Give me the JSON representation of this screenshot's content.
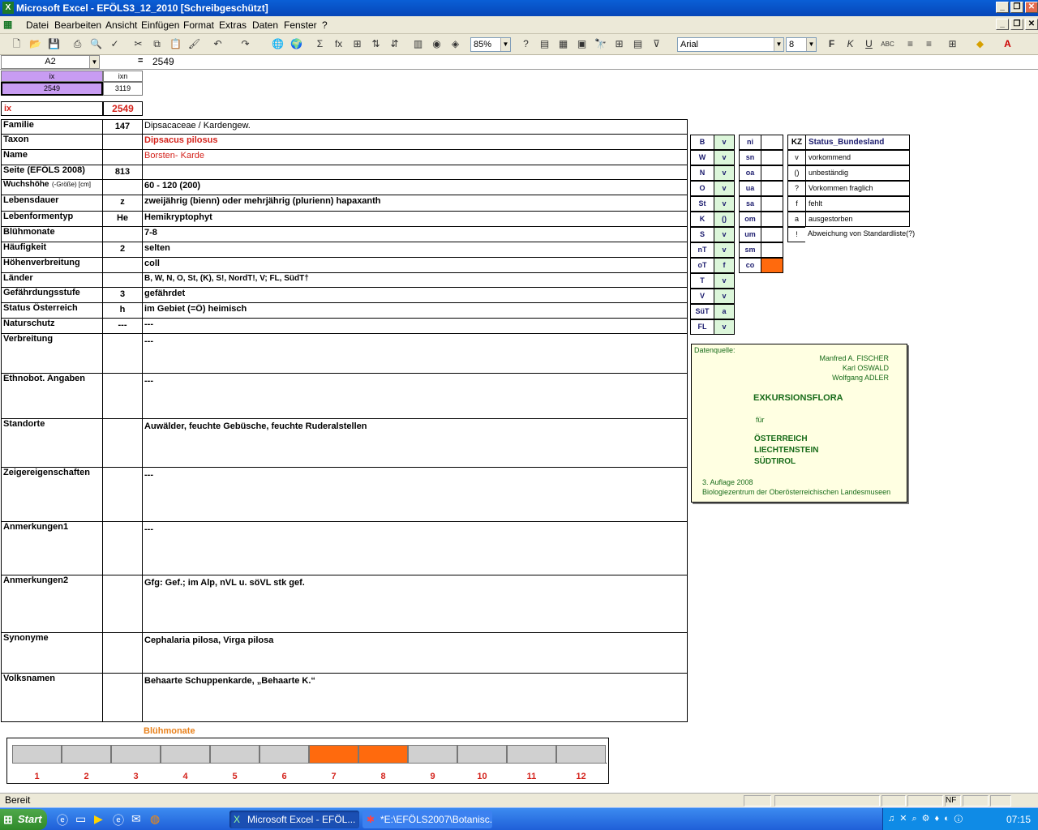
{
  "window": {
    "title": "Microsoft Excel - EFÖLS3_12_2010  [Schreibgeschützt]"
  },
  "menu": [
    "Datei",
    "Bearbeiten",
    "Ansicht",
    "Einfügen",
    "Format",
    "Extras",
    "Daten",
    "Fenster",
    "?"
  ],
  "toolbar": {
    "zoom": "85%",
    "font": "Arial",
    "font_size": "8"
  },
  "formula": {
    "namebox": "A2",
    "fx": "=",
    "value": "2549"
  },
  "header": {
    "ix_label": "ix",
    "ixn_label": "ixn",
    "ix_value": "2549",
    "ixn_value": "3119",
    "ix2_label": "ix",
    "ix2_value": "2549"
  },
  "rows": [
    {
      "label": "Familie",
      "code": "147",
      "value": "Dipsacaceae  /  Kardengew."
    },
    {
      "label": "Taxon",
      "code": "",
      "value": "Dipsacus pilosus"
    },
    {
      "label": "Name",
      "code": "",
      "value": "Borsten- Karde"
    },
    {
      "label": "Seite (EFÖLS 2008)",
      "code": "813",
      "value": ""
    },
    {
      "label": "Wuchshöhe",
      "label_small": "(-Größe) [cm]",
      "code": "",
      "value": " 60 - 120 (200)"
    },
    {
      "label": "Lebensdauer",
      "code": "z",
      "value": "zweijährig (bienn) oder mehrjährig (plurienn) hapaxanth"
    },
    {
      "label": "Lebenformentyp",
      "code": "He",
      "value": "Hemikryptophyt"
    },
    {
      "label": "Blühmonate",
      "code": "",
      "value": " 7-8"
    },
    {
      "label": "Häufigkeit",
      "code": "2",
      "value": "selten"
    },
    {
      "label": "Höhenverbreitung",
      "code": "",
      "value": "coll"
    },
    {
      "label": "Länder",
      "code": "",
      "value": "B, W, N, O, St, (K), S!, NordT!, V; FL, SüdT†"
    },
    {
      "label": "Gefährdungsstufe",
      "code": "3",
      "value": "gefährdet"
    },
    {
      "label": "Status Österreich",
      "code": "h",
      "value": "im Gebiet (=Ö) heimisch"
    },
    {
      "label": "Naturschutz",
      "code": "---",
      "value": " ---"
    },
    {
      "label": "Verbreitung",
      "code": "",
      "value": " ---"
    },
    {
      "label": "Ethnobot. Angaben",
      "code": "",
      "value": "---"
    },
    {
      "label": "Standorte",
      "code": "",
      "value": "Auwälder, feuchte Gebüsche, feuchte Ruderalstellen"
    },
    {
      "label": "Zeigereigenschaften",
      "code": "",
      "value": "---"
    },
    {
      "label": "Anmerkungen1",
      "code": "",
      "value": "---"
    },
    {
      "label": "Anmerkungen2",
      "code": "",
      "value": "Gfg: Gef.; im Alp, nVL u. söVL stk gef."
    },
    {
      "label": "Synonyme",
      "code": "",
      "value": "Cephalaria pilosa, Virga pilosa"
    },
    {
      "label": "Volksnamen",
      "code": "",
      "value": "Behaarte Schuppenkarde, „Behaarte K.“"
    }
  ],
  "states": [
    [
      "B",
      "v"
    ],
    [
      "W",
      "v"
    ],
    [
      "N",
      "v"
    ],
    [
      "O",
      "v"
    ],
    [
      "St",
      "v"
    ],
    [
      "K",
      "()"
    ],
    [
      "S",
      "v"
    ],
    [
      "nT",
      "v"
    ],
    [
      "oT",
      "f"
    ],
    [
      "T",
      "v"
    ],
    [
      "V",
      "v"
    ],
    [
      "SüT",
      "a"
    ],
    [
      "FL",
      "v"
    ]
  ],
  "heights": [
    [
      "ni",
      ""
    ],
    [
      "sn",
      ""
    ],
    [
      "oa",
      ""
    ],
    [
      "ua",
      ""
    ],
    [
      "sa",
      ""
    ],
    [
      "om",
      ""
    ],
    [
      "um",
      ""
    ],
    [
      "sm",
      ""
    ],
    [
      "co",
      ""
    ]
  ],
  "legend": {
    "head_kz": "KZ",
    "head_status": "Status_Bundesland",
    "items": [
      [
        "v",
        "vorkommend"
      ],
      [
        "()",
        "unbeständig"
      ],
      [
        "?",
        "Vorkommen fraglich"
      ],
      [
        "f",
        "fehlt"
      ],
      [
        "a",
        "ausgestorben"
      ],
      [
        "!",
        "Abweichung von Standardliste(?)"
      ]
    ]
  },
  "datasource": {
    "label": "Datenquelle:",
    "authors": [
      "Manfred A. FISCHER",
      "Karl OSWALD",
      "Wolfgang ADLER"
    ],
    "book": "EXKURSIONSFLORA",
    "fuer": "für",
    "countries": [
      "ÖSTERREICH",
      "LIECHTENSTEIN",
      "SÜDTIROL"
    ],
    "edition": "3. Auflage 2008",
    "publisher": "Biologiezentrum der Oberösterreichischen Landesmuseen"
  },
  "bloom": {
    "title": "Blühmonate",
    "months": [
      "1",
      "2",
      "3",
      "4",
      "5",
      "6",
      "7",
      "8",
      "9",
      "10",
      "11",
      "12"
    ],
    "active": [
      7,
      8
    ],
    "highlight_color": "#ff6a0d"
  },
  "status": {
    "text": "Bereit",
    "nf": "NF"
  },
  "taskbar": {
    "start": "Start",
    "tasks": [
      "Microsoft Excel - EFÖL...",
      "*E:\\EFÖLS2007\\Botanisc..."
    ],
    "time": "07:15"
  }
}
